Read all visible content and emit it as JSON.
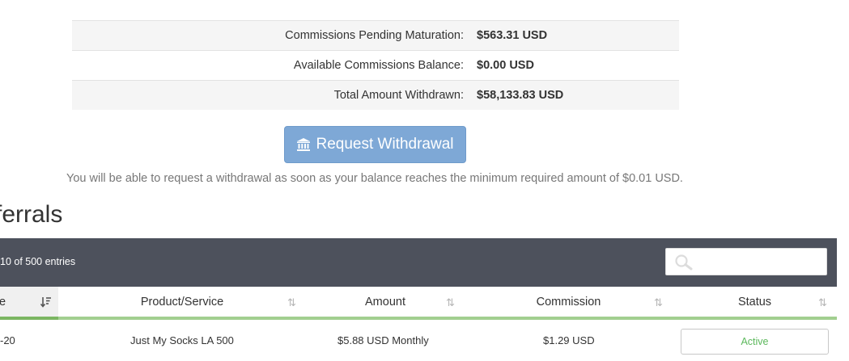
{
  "stats": [
    {
      "label": "Commissions Pending Maturation:",
      "value": "$563.31 USD"
    },
    {
      "label": "Available Commissions Balance:",
      "value": "$0.00 USD"
    },
    {
      "label": "Total Amount Withdrawn:",
      "value": "$58,133.83 USD"
    }
  ],
  "withdraw": {
    "button_label": "Request Withdrawal",
    "note": "You will be able to request a withdrawal as soon as your balance reaches the minimum required amount of $0.01 USD."
  },
  "referrals": {
    "title": "ferrals",
    "entries_info": "10 of 500 entries",
    "search_placeholder": "",
    "columns": [
      "te",
      "Product/Service",
      "Amount",
      "Commission",
      "Status"
    ],
    "rows": [
      {
        "date": "-20",
        "product": "Just My Socks LA 500",
        "amount": "$5.88 USD Monthly",
        "commission": "$1.29 USD",
        "status": "Active"
      }
    ]
  },
  "colors": {
    "button": "#7ea8d6",
    "bar": "#4d515c",
    "accent_green": "#a2cf90",
    "status_active": "#5cb85c"
  }
}
